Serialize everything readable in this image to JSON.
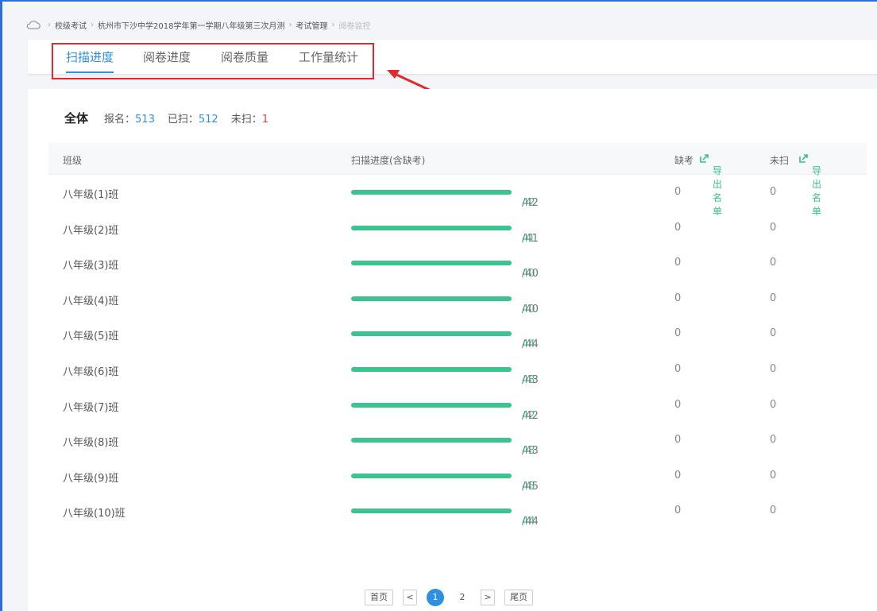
{
  "breadcrumb": {
    "items": [
      "校级考试",
      "杭州市下沙中学2018学年第一学期八年级第三次月测",
      "考试管理"
    ],
    "current": "阅卷监控"
  },
  "tabs": [
    {
      "label": "扫描进度",
      "active": true
    },
    {
      "label": "阅卷进度",
      "active": false
    },
    {
      "label": "阅卷质量",
      "active": false
    },
    {
      "label": "工作量统计",
      "active": false
    }
  ],
  "summary": {
    "scope": "全体",
    "registered_label": "报名：",
    "registered": "513",
    "scanned_label": "已扫：",
    "scanned": "512",
    "unscanned_label": "未扫：",
    "unscanned": "1"
  },
  "table": {
    "headers": {
      "class": "班级",
      "progress": "扫描进度(含缺考)",
      "absent": "缺考",
      "unscanned": "未扫",
      "export": "导出名单"
    },
    "rows": [
      {
        "class": "八年级(1)班",
        "done": "42",
        "total": "/42",
        "progress": 1.0,
        "absent": "0",
        "unscanned": "0"
      },
      {
        "class": "八年级(2)班",
        "done": "41",
        "total": "/41",
        "progress": 1.0,
        "absent": "0",
        "unscanned": "0"
      },
      {
        "class": "八年级(3)班",
        "done": "40",
        "total": "/40",
        "progress": 1.0,
        "absent": "0",
        "unscanned": "0"
      },
      {
        "class": "八年级(4)班",
        "done": "40",
        "total": "/40",
        "progress": 1.0,
        "absent": "0",
        "unscanned": "0"
      },
      {
        "class": "八年级(5)班",
        "done": "44",
        "total": "/44",
        "progress": 1.0,
        "absent": "0",
        "unscanned": "0"
      },
      {
        "class": "八年级(6)班",
        "done": "43",
        "total": "/43",
        "progress": 1.0,
        "absent": "0",
        "unscanned": "0"
      },
      {
        "class": "八年级(7)班",
        "done": "42",
        "total": "/42",
        "progress": 1.0,
        "absent": "0",
        "unscanned": "0"
      },
      {
        "class": "八年级(8)班",
        "done": "43",
        "total": "/43",
        "progress": 1.0,
        "absent": "0",
        "unscanned": "0"
      },
      {
        "class": "八年级(9)班",
        "done": "45",
        "total": "/45",
        "progress": 1.0,
        "absent": "0",
        "unscanned": "0"
      },
      {
        "class": "八年级(10)班",
        "done": "44",
        "total": "/44",
        "progress": 1.0,
        "absent": "0",
        "unscanned": "0"
      }
    ]
  },
  "pagination": {
    "first": "首页",
    "prev": "<",
    "pages": [
      "1",
      "2"
    ],
    "current": "1",
    "next": ">",
    "last": "尾页"
  },
  "colors": {
    "accent": "#2f8fe0",
    "progress": "#3cc48e",
    "highlight": "#e0292c",
    "unscanned_value": "#e0403c"
  },
  "icons": {
    "home": "cloud-home-icon",
    "export": "export-icon"
  }
}
